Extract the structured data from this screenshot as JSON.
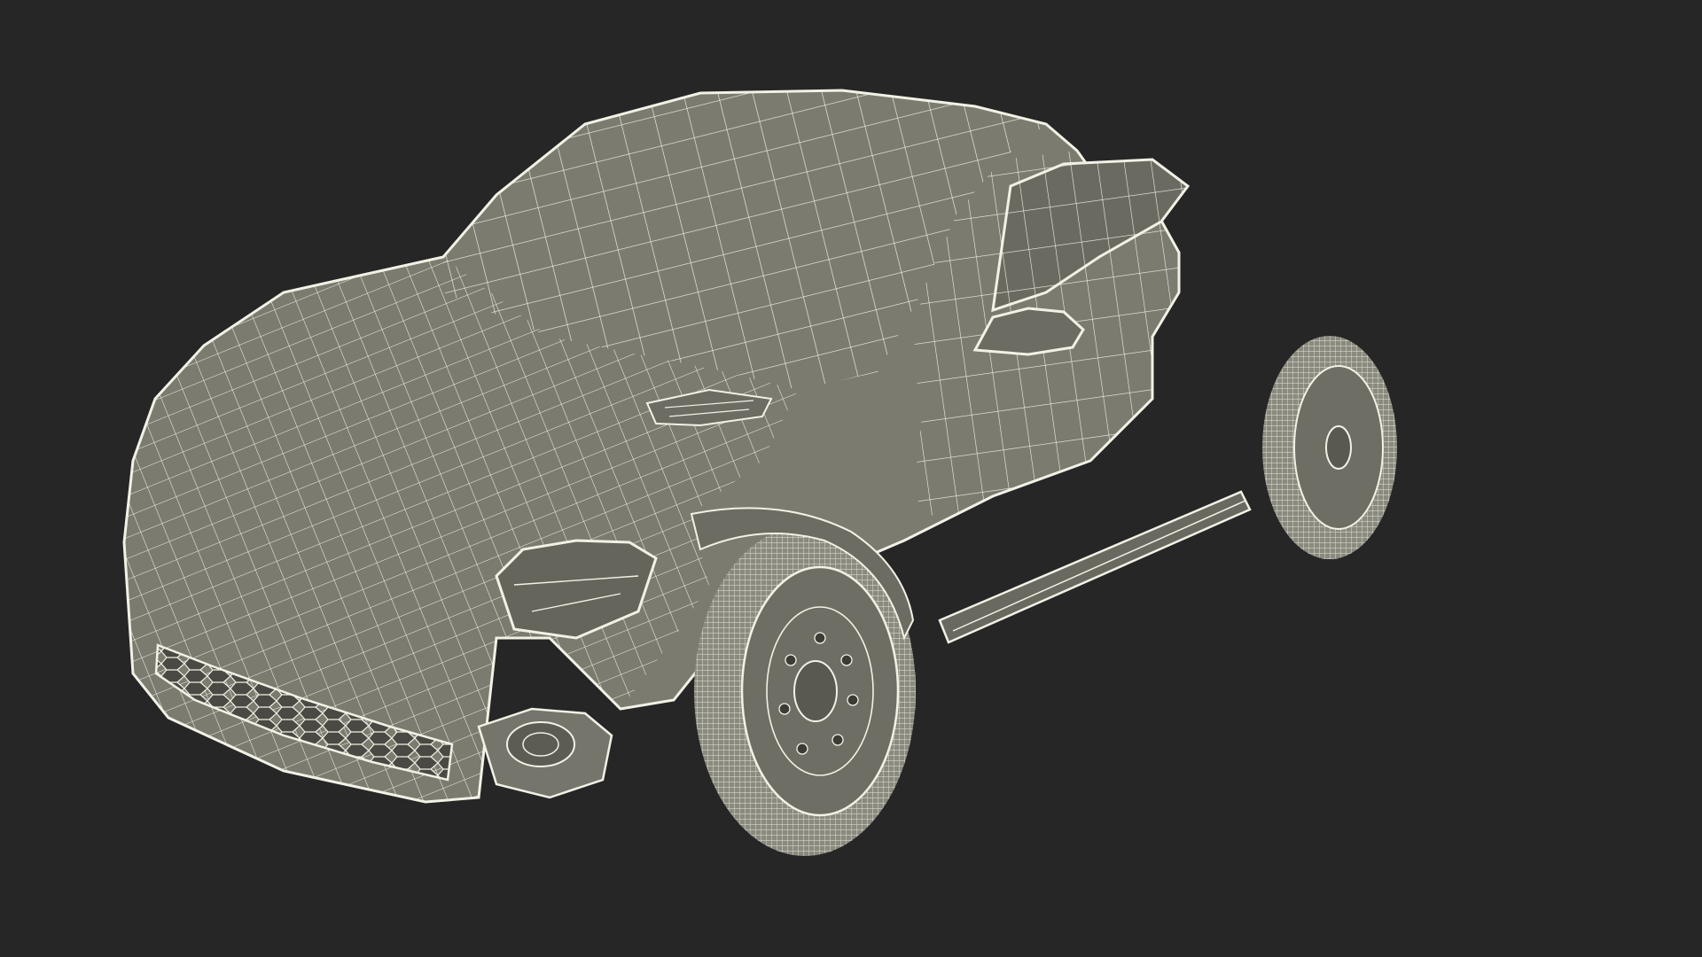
{
  "scene": {
    "background_color": "#262626",
    "mesh_fill_color": "#7c7b70",
    "mesh_shade_color": "#5f5e55",
    "wire_color": "#f2f1e6",
    "subject": "car-wireframe"
  }
}
